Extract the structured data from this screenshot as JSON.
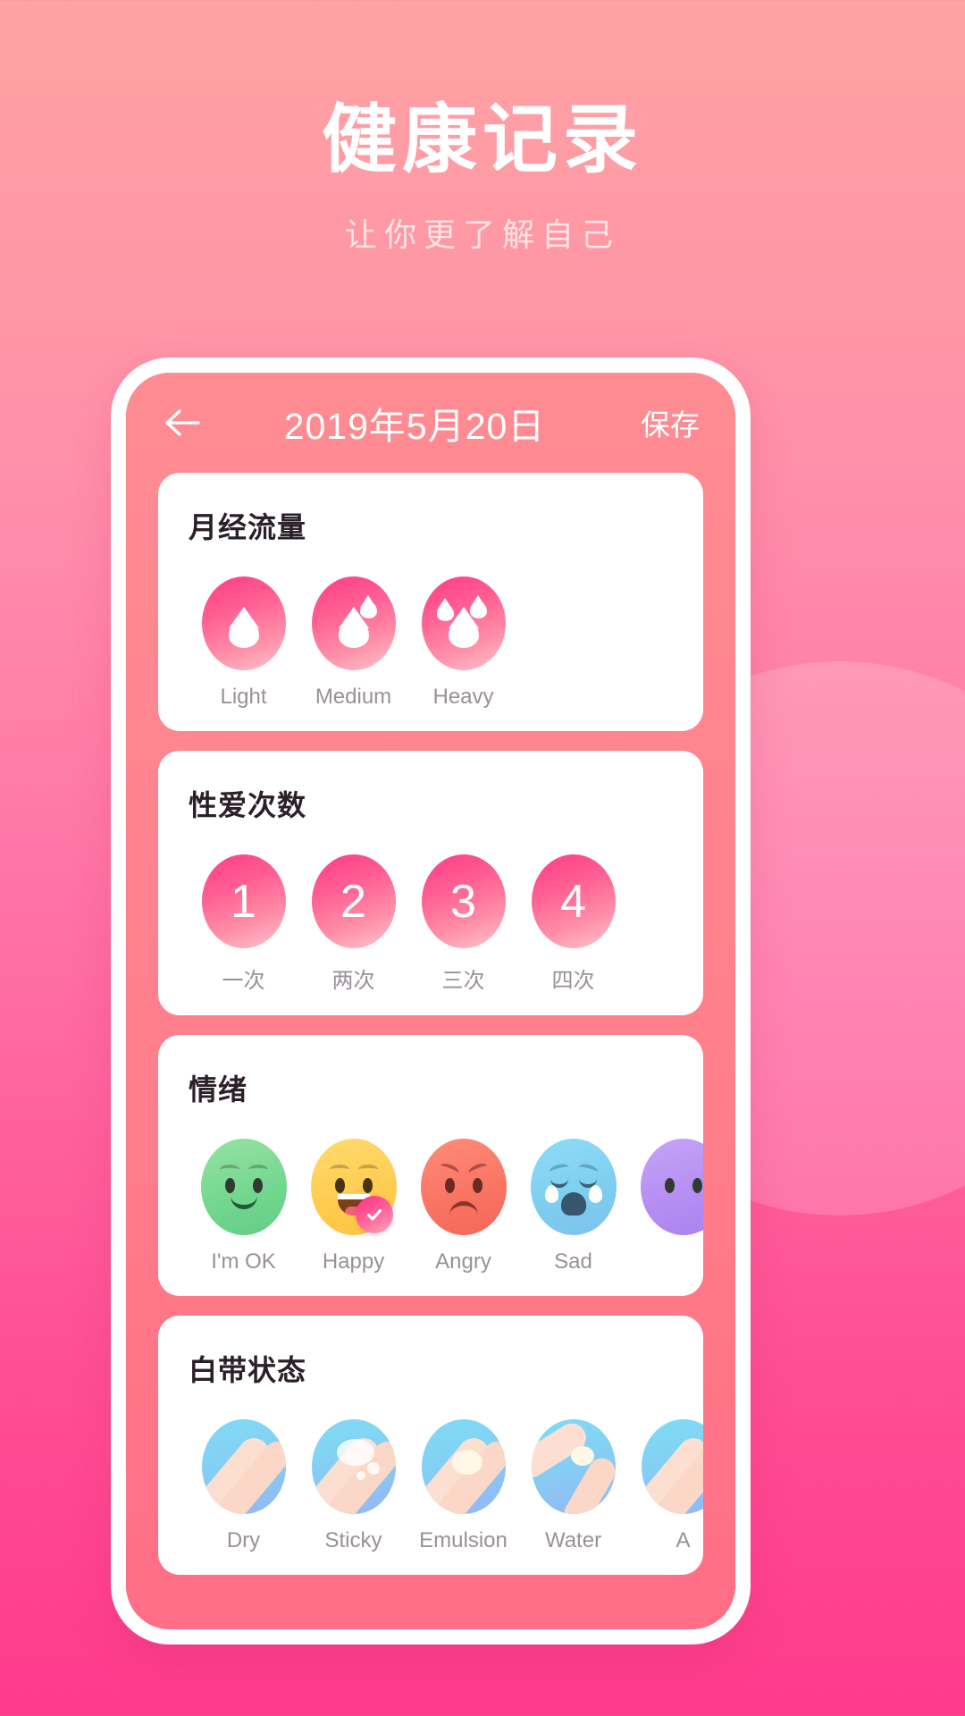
{
  "hero": {
    "title": "健康记录",
    "subtitle": "让你更了解自己"
  },
  "phone": {
    "navbar": {
      "back_icon": "arrow-left-icon",
      "title": "2019年5月20日",
      "save_label": "保存"
    },
    "cards": [
      {
        "id": "menstrual-flow",
        "title": "月经流量",
        "options": [
          {
            "label": "Light",
            "icon": "drop-1-icon",
            "selected": false
          },
          {
            "label": "Medium",
            "icon": "drop-2-icon",
            "selected": false
          },
          {
            "label": "Heavy",
            "icon": "drop-3-icon",
            "selected": false
          }
        ]
      },
      {
        "id": "sex-count",
        "title": "性爱次数",
        "options": [
          {
            "label": "一次",
            "value": "1",
            "selected": false
          },
          {
            "label": "两次",
            "value": "2",
            "selected": false
          },
          {
            "label": "三次",
            "value": "3",
            "selected": false
          },
          {
            "label": "四次",
            "value": "4",
            "selected": false
          }
        ]
      },
      {
        "id": "mood",
        "title": "情绪",
        "options": [
          {
            "label": "I'm OK",
            "icon": "face-neutral-green-icon",
            "selected": false
          },
          {
            "label": "Happy",
            "icon": "face-happy-yellow-icon",
            "selected": true
          },
          {
            "label": "Angry",
            "icon": "face-angry-red-icon",
            "selected": false
          },
          {
            "label": "Sad",
            "icon": "face-crying-blue-icon",
            "selected": false
          },
          {
            "label": "",
            "icon": "face-purple-icon",
            "selected": false
          }
        ]
      },
      {
        "id": "discharge",
        "title": "白带状态",
        "options": [
          {
            "label": "Dry",
            "icon": "discharge-dry-icon",
            "selected": false
          },
          {
            "label": "Sticky",
            "icon": "discharge-sticky-icon",
            "selected": false
          },
          {
            "label": "Emulsion",
            "icon": "discharge-emulsion-icon",
            "selected": false
          },
          {
            "label": "Water",
            "icon": "discharge-water-icon",
            "selected": false
          },
          {
            "label": "A",
            "icon": "discharge-partial-icon",
            "selected": false
          }
        ]
      }
    ]
  },
  "colors": {
    "bg_top": "#FFA3A3",
    "bg_bottom": "#FF3A8C",
    "accent_pink": "#FF2E84",
    "card_bg": "#FFFFFF",
    "label_gray": "#9A9098",
    "title_dark": "#2C2028"
  }
}
